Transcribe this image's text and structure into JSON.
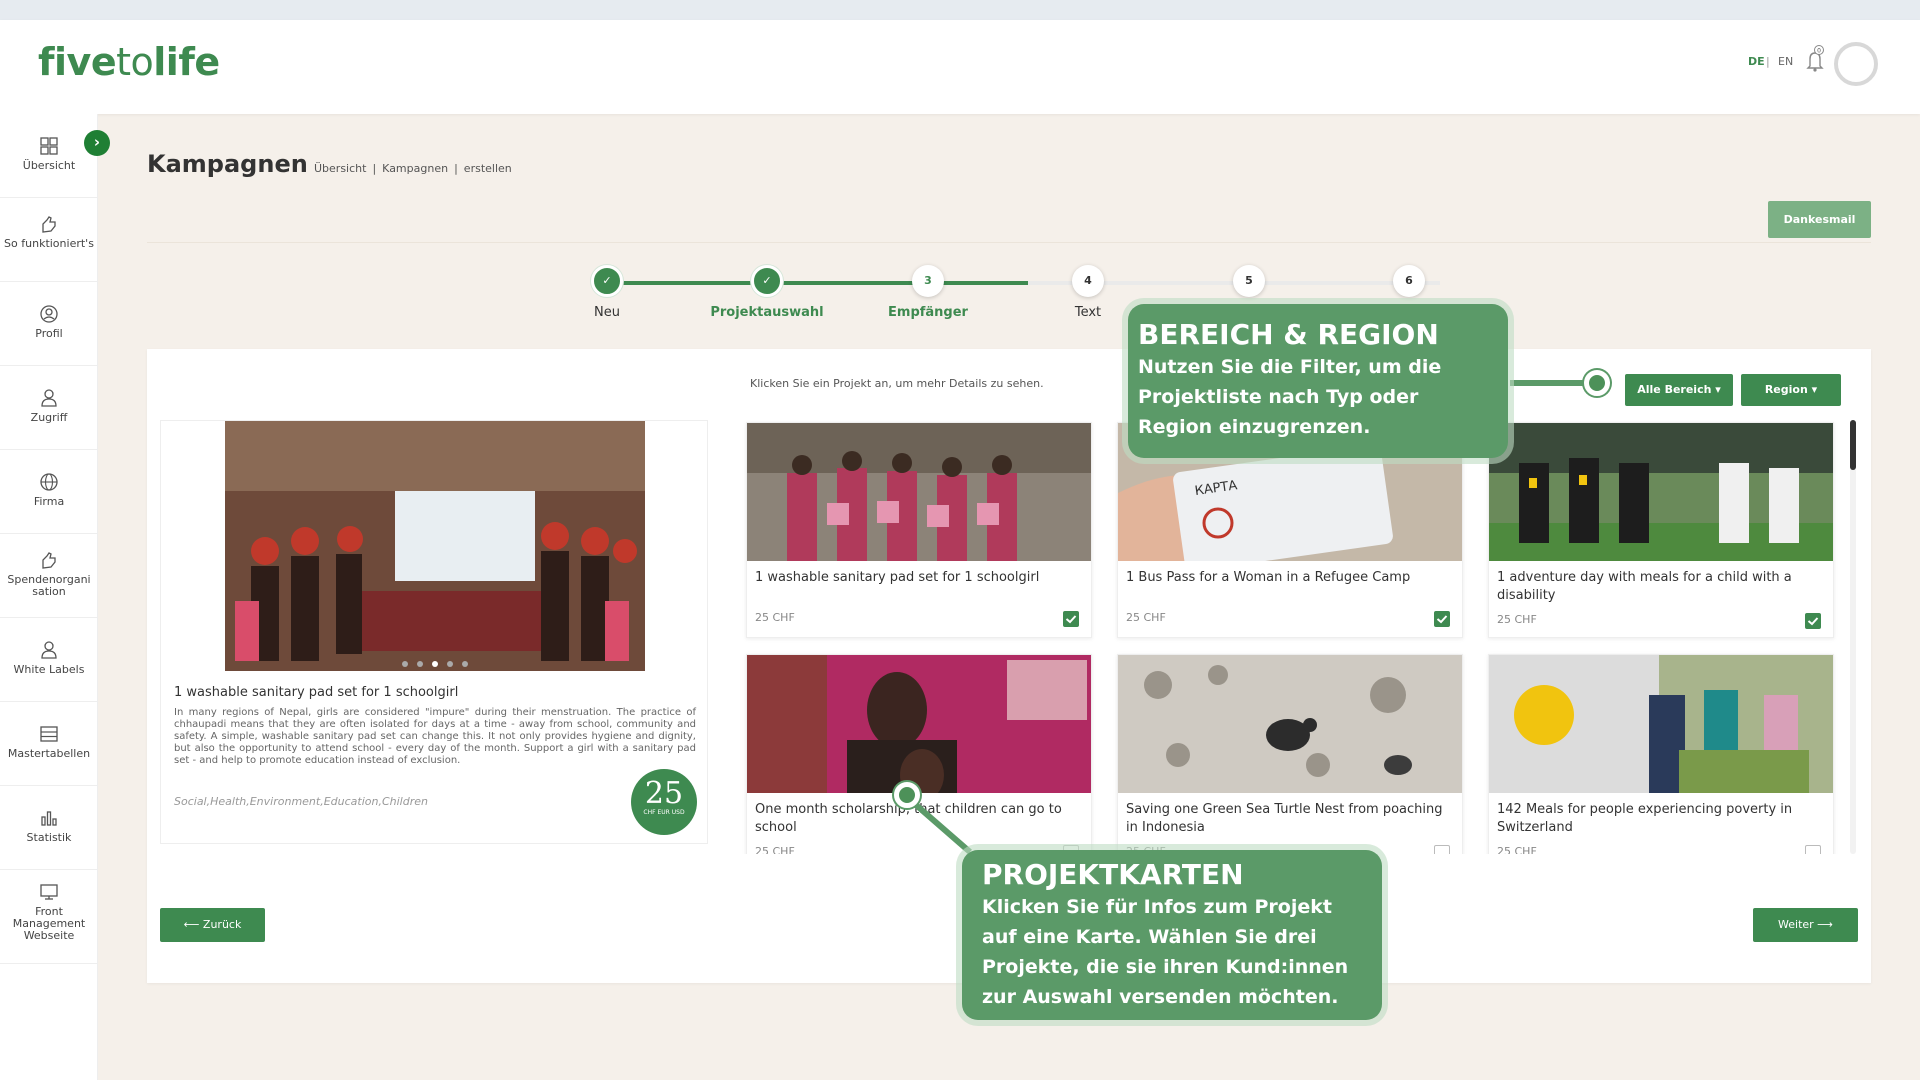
{
  "app": {
    "logo_bold": "five",
    "logo_mid": "to",
    "logo_end": "life"
  },
  "header": {
    "lang_de": "DE",
    "lang_sep": "|",
    "lang_en": "EN",
    "bell_count": "0"
  },
  "sidebar": {
    "items": [
      {
        "label": "Übersicht",
        "icon": "grid-icon"
      },
      {
        "label": "So funktioniert's",
        "icon": "hand-icon"
      },
      {
        "label": "Profil",
        "icon": "user-circle-icon"
      },
      {
        "label": "Zugriff",
        "icon": "user-key-icon"
      },
      {
        "label": "Firma",
        "icon": "globe-icon"
      },
      {
        "label": "Spendenorganisation",
        "icon": "hand-heart-icon"
      },
      {
        "label": "White Labels",
        "icon": "user-label-icon"
      },
      {
        "label": "Mastertabellen",
        "icon": "table-icon"
      },
      {
        "label": "Statistik",
        "icon": "bar-chart-icon"
      },
      {
        "label": "Front Management Webseite",
        "icon": "monitor-icon"
      }
    ],
    "toggle_glyph": "›"
  },
  "page": {
    "title": "Kampagnen",
    "breadcrumb": [
      "Übersicht",
      "|",
      "Kampagnen",
      "|",
      "erstellen"
    ],
    "dank_button": "Dankesmail"
  },
  "stepper": {
    "steps": [
      {
        "label": "Neu",
        "state": "done",
        "num": "1"
      },
      {
        "label": "Projektauswahl",
        "state": "done",
        "num": "2"
      },
      {
        "label": "Empfänger",
        "state": "current",
        "num": "3"
      },
      {
        "label": "Text",
        "state": "todo",
        "num": "4"
      },
      {
        "label": "",
        "state": "todo",
        "num": "5"
      },
      {
        "label": "",
        "state": "todo",
        "num": "6"
      }
    ],
    "check_glyph": "✓"
  },
  "projects": {
    "hint": "Klicken Sie ein Projekt an, um mehr Details zu sehen.",
    "filter_area": "Alle Bereich ▾",
    "filter_region": "Region ▾",
    "detail": {
      "title": "1 washable sanitary pad set for 1 schoolgirl",
      "text": "In many regions of Nepal, girls are considered \"impure\" during their menstruation. The practice of chhaupadi means that they are often isolated for days at a time - away from school, community and safety. A simple, washable sanitary pad set can change this. It not only provides hygiene and dignity, but also the opportunity to attend school - every day of the month. Support a girl with a sanitary pad set - and help to promote education instead of exclusion.",
      "tags": "Social,Health,Environment,Education,Children",
      "amount": "25",
      "currencies": "CHF EUR USD"
    },
    "cards": [
      {
        "title": "1 washable sanitary pad set for 1 schoolgirl",
        "price": "25 CHF",
        "checked": true
      },
      {
        "title": "1 Bus Pass for a Woman in a Refugee Camp",
        "price": "25 CHF",
        "checked": true
      },
      {
        "title": "1 adventure day with meals for a child with a disability",
        "price": "25 CHF",
        "checked": true
      },
      {
        "title": "One month scholarship, that children can go to school",
        "price": "25 CHF",
        "checked": false
      },
      {
        "title": "Saving one Green Sea Turtle Nest from poaching in Indonesia",
        "price": "25 CHF",
        "checked": false
      },
      {
        "title": "142 Meals for people experiencing poverty in Switzerland",
        "price": "25 CHF",
        "checked": false
      }
    ],
    "back_button": "⟵  Zurück",
    "next_button": "Weiter  ⟶"
  },
  "tooltips": {
    "filter": {
      "title": "BEREICH & REGION",
      "text": "Nutzen Sie die Filter, um die Projektliste nach Typ oder Region einzugrenzen."
    },
    "cards": {
      "title": "PROJEKTKARTEN",
      "text": "Klicken Sie für Infos zum Projekt auf eine Karte. Wählen Sie drei Projekte, die sie ihren Kund:innen zur Auswahl versenden möchten."
    }
  },
  "colors": {
    "brand": "#3e8a50",
    "tip": "#5b9a68",
    "bg": "#f5f0ea"
  }
}
